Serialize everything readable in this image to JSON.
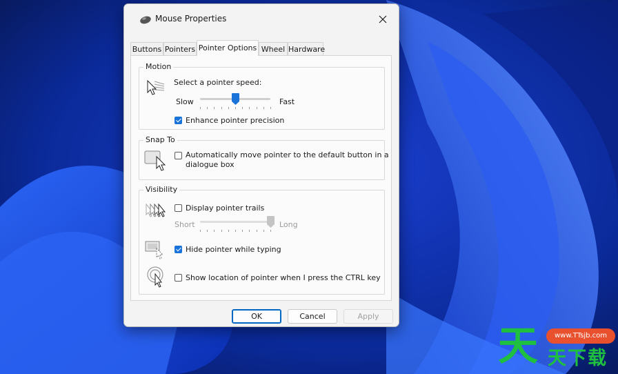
{
  "window": {
    "title": "Mouse Properties",
    "close_icon": "close-icon",
    "app_icon": "mouse-icon"
  },
  "tabs": [
    {
      "label": "Buttons",
      "active": false
    },
    {
      "label": "Pointers",
      "active": false
    },
    {
      "label": "Pointer Options",
      "active": true
    },
    {
      "label": "Wheel",
      "active": false
    },
    {
      "label": "Hardware",
      "active": false
    }
  ],
  "motion": {
    "group_label": "Motion",
    "prompt": "Select a pointer speed:",
    "slow_label": "Slow",
    "fast_label": "Fast",
    "speed_fraction": 0.5,
    "enhance_label": "Enhance pointer precision",
    "enhance_checked": true
  },
  "snap_to": {
    "group_label": "Snap To",
    "label_line1": "Automatically move pointer to the default button in a",
    "label_line2": "dialogue box",
    "checked": false
  },
  "visibility": {
    "group_label": "Visibility",
    "trails_label": "Display pointer trails",
    "trails_checked": false,
    "short_label": "Short",
    "long_label": "Long",
    "trails_fraction": 1.0,
    "hide_label": "Hide pointer while typing",
    "hide_checked": true,
    "ctrl_label": "Show location of pointer when I press the CTRL key",
    "ctrl_checked": false
  },
  "footer": {
    "ok_label": "OK",
    "cancel_label": "Cancel",
    "apply_label": "Apply"
  },
  "watermark": {
    "char1": "天",
    "url": "www.TTsjb.com",
    "chars": "天下载"
  },
  "colors": {
    "accent": "#0067c0",
    "desktop_bg": "#0b1f6e",
    "watermark_green": "#1fbf3f",
    "watermark_red": "#e8502e"
  }
}
